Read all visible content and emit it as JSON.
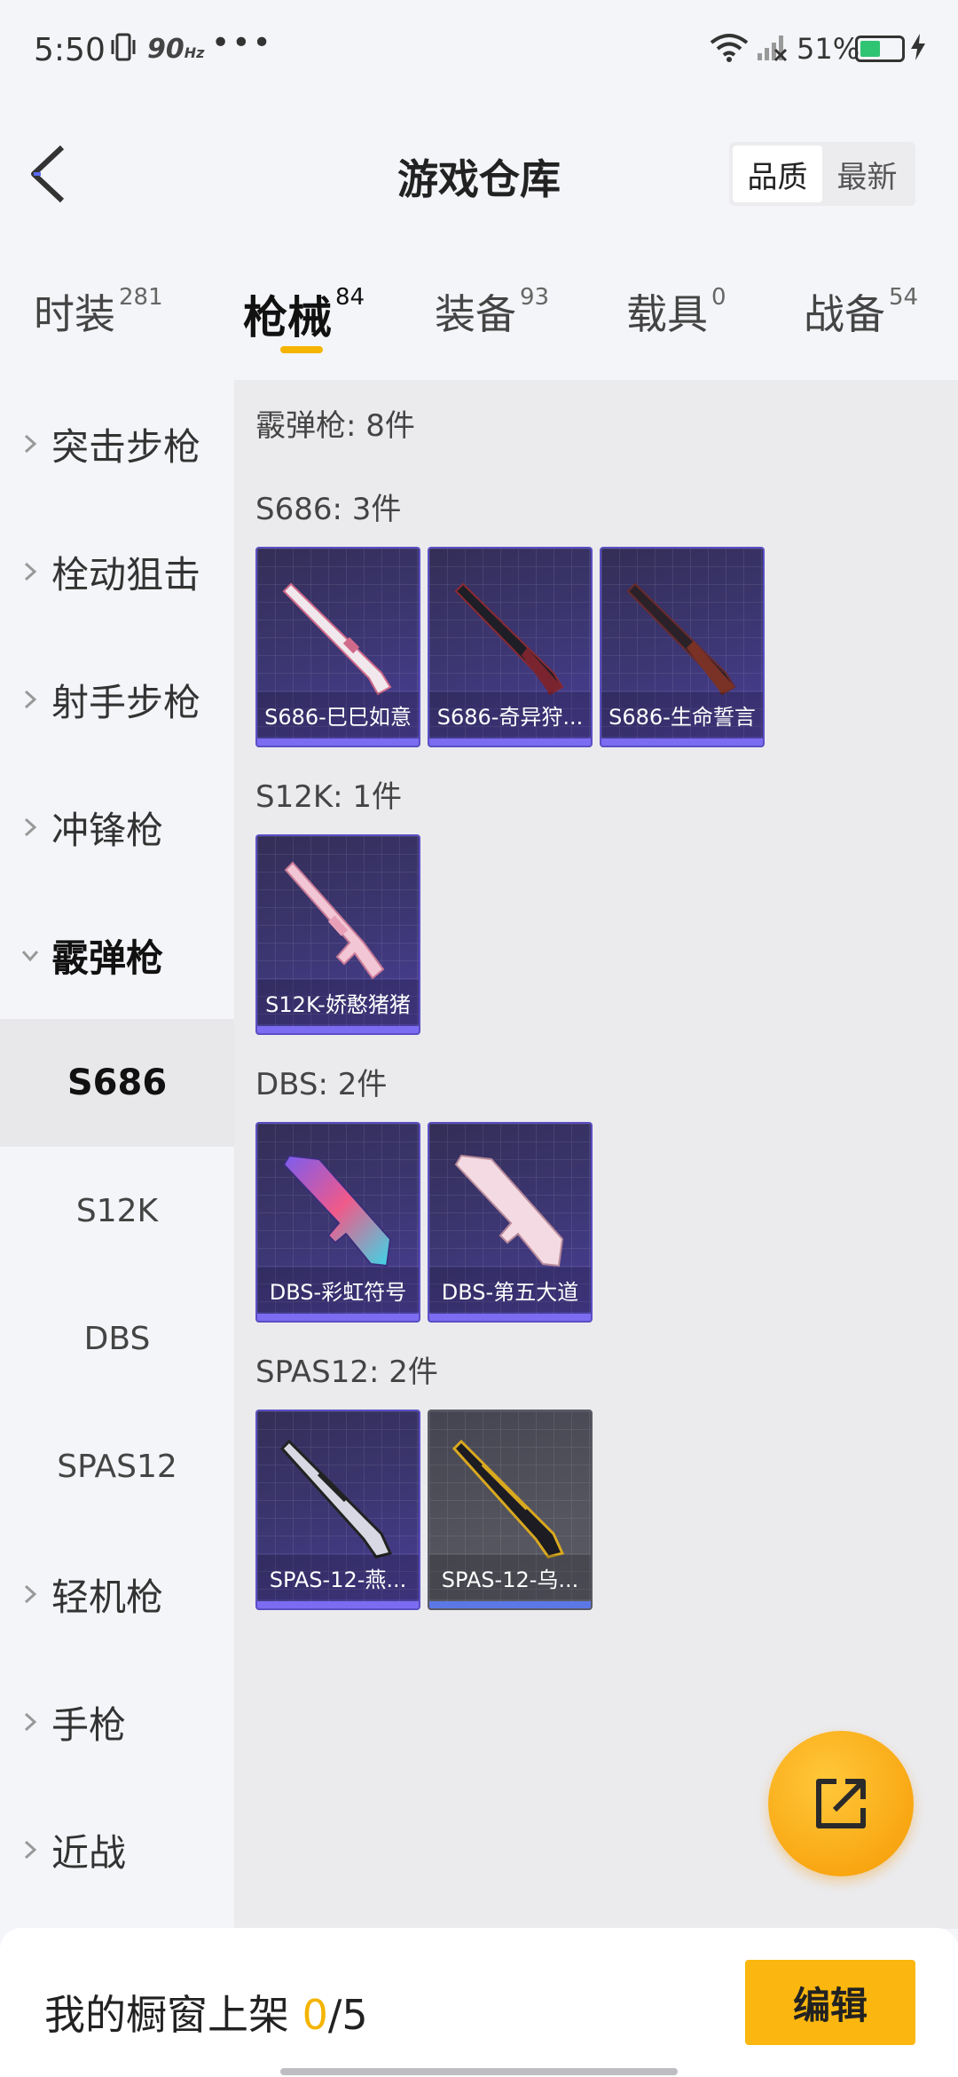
{
  "status_bar": {
    "time": "5:50",
    "refresh_rate": "90",
    "refresh_unit": "Hz",
    "more": "•••",
    "battery_percent": "51%",
    "battery_level": 0.51
  },
  "header": {
    "title": "游戏仓库",
    "sort_options": [
      "品质",
      "最新"
    ],
    "sort_selected": "品质"
  },
  "tabs": [
    {
      "label": "时装",
      "count": "281"
    },
    {
      "label": "枪械",
      "count": "84",
      "active": true
    },
    {
      "label": "装备",
      "count": "93"
    },
    {
      "label": "载具",
      "count": "0"
    },
    {
      "label": "战备",
      "count": "54"
    }
  ],
  "sidebar": {
    "items": [
      {
        "label": "突击步枪"
      },
      {
        "label": "栓动狙击"
      },
      {
        "label": "射手步枪"
      },
      {
        "label": "冲锋枪"
      },
      {
        "label": "霰弹枪",
        "expanded": true
      },
      {
        "label": "S686",
        "sub": true,
        "active": true
      },
      {
        "label": "S12K",
        "sub": true
      },
      {
        "label": "DBS",
        "sub": true
      },
      {
        "label": "SPAS12",
        "sub": true
      },
      {
        "label": "轻机枪"
      },
      {
        "label": "手枪"
      },
      {
        "label": "近战"
      }
    ]
  },
  "main": {
    "total": "霰弹枪: 8件",
    "groups": [
      {
        "title": "S686: 3件",
        "items": [
          {
            "name": "S686-巳巳如意",
            "icon": "shotgun-white-pink"
          },
          {
            "name": "S686-奇异狩...",
            "icon": "shotgun-dark-red"
          },
          {
            "name": "S686-生命誓言",
            "icon": "shotgun-brown"
          }
        ]
      },
      {
        "title": "S12K: 1件",
        "items": [
          {
            "name": "S12K-娇憨猪猪",
            "icon": "rifle-pink"
          }
        ]
      },
      {
        "title": "DBS: 2件",
        "items": [
          {
            "name": "DBS-彩虹符号",
            "icon": "dbs-rainbow"
          },
          {
            "name": "DBS-第五大道",
            "icon": "dbs-pink-white"
          }
        ]
      },
      {
        "title": "SPAS12: 2件",
        "items": [
          {
            "name": "SPAS-12-燕...",
            "icon": "spas-white-black"
          },
          {
            "name": "SPAS-12-乌...",
            "icon": "spas-gold-black",
            "grey": true
          }
        ]
      }
    ]
  },
  "share_button": {
    "icon": "share-external-icon"
  },
  "bottom_bar": {
    "label": "我的橱窗上架",
    "count_current": "0",
    "count_total": "/5",
    "edit_label": "编辑"
  },
  "colors": {
    "accent": "#f4b400",
    "card_purple": "#3d3775",
    "card_grey": "#55555f"
  }
}
